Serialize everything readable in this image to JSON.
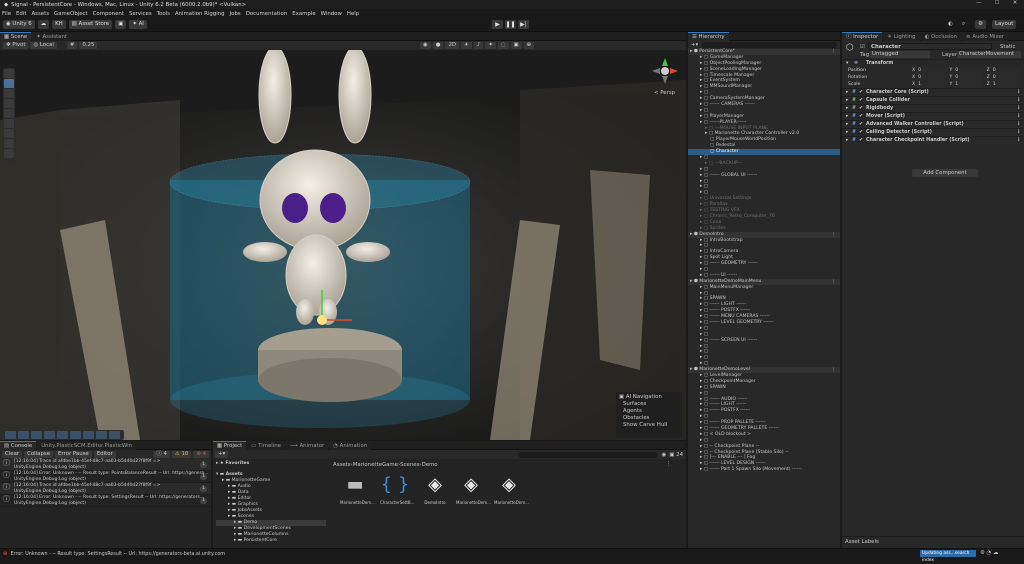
{
  "window": {
    "title": "Signal - PersistentCore - Windows, Mac, Linux - Unity 6.2 Beta (6000.2.0b9)* <Vulkan>",
    "minimize": "—",
    "maximize": "☐",
    "close": "✕"
  },
  "menu": [
    "File",
    "Edit",
    "Assets",
    "GameObject",
    "Component",
    "Services",
    "Tools",
    "Animation Rigging",
    "Jobs",
    "Documentation",
    "Example",
    "Window",
    "Help"
  ],
  "toolbar": {
    "account": "Unity 6",
    "user": "KH",
    "asset_store": "Asset Store",
    "ai": "AI",
    "layout": "Layout"
  },
  "scene_tabs": [
    "Scene",
    "Assistant"
  ],
  "scene_tools": {
    "pivot": "Pivot",
    "local": "Local",
    "snap": "0.25",
    "persp": "< Persp"
  },
  "ai_navigation": {
    "title": "AI Navigation",
    "items": [
      "Surfaces",
      "Agents",
      "Obstacles",
      "Show Carve Hull"
    ]
  },
  "hierarchy": {
    "tab": "Hierarchy",
    "rows": [
      {
        "t": "PersistentCore*",
        "d": 0,
        "k": "scene"
      },
      {
        "t": "GameManager",
        "d": 2
      },
      {
        "t": "ObjectPoolingManager",
        "d": 2
      },
      {
        "t": "SceneLoadingManager",
        "d": 2
      },
      {
        "t": "Timescale Manager",
        "d": 2
      },
      {
        "t": "EventSystem",
        "d": 2
      },
      {
        "t": "MMSoundManager",
        "d": 2
      },
      {
        "t": "",
        "d": 2
      },
      {
        "t": "CameraSystemManager",
        "d": 2
      },
      {
        "t": "------ CAMERAS ------",
        "d": 2
      },
      {
        "t": "",
        "d": 2
      },
      {
        "t": "PlayerManager",
        "d": 2
      },
      {
        "t": "------PLAYER------",
        "d": 2
      },
      {
        "t": "---MOUSE INPUT PLANE",
        "d": 3,
        "k": "dim"
      },
      {
        "t": "Marionette Character Controller v2.0",
        "d": 3
      },
      {
        "t": "PlayerMouseWorldPosition",
        "d": 4
      },
      {
        "t": "Pedestal",
        "d": 4
      },
      {
        "t": "Character",
        "d": 4,
        "k": "sel"
      },
      {
        "t": "",
        "d": 2
      },
      {
        "t": "---BACKUP---",
        "d": 3,
        "k": "dim"
      },
      {
        "t": "",
        "d": 2
      },
      {
        "t": "------ GLOBAL UI ------",
        "d": 2
      },
      {
        "t": "",
        "d": 2
      },
      {
        "t": "",
        "d": 2
      },
      {
        "t": "",
        "d": 2
      },
      {
        "t": "Universal Settings",
        "d": 2,
        "k": "dim"
      },
      {
        "t": "Parallax",
        "d": 2,
        "k": "dim"
      },
      {
        "t": "TESTING VFX",
        "d": 2,
        "k": "dim"
      },
      {
        "t": "Chronic_Retro_Computer_76",
        "d": 2,
        "k": "dim"
      },
      {
        "t": "Cone",
        "d": 2,
        "k": "dim"
      },
      {
        "t": "Sprites",
        "d": 2,
        "k": "dim"
      },
      {
        "t": "DemoIntro",
        "d": 0,
        "k": "scene"
      },
      {
        "t": "IntroBootstrap",
        "d": 2
      },
      {
        "t": "",
        "d": 2
      },
      {
        "t": "IntroCamera",
        "d": 2
      },
      {
        "t": "Spot Light",
        "d": 2
      },
      {
        "t": "------ GEOMETRY ------",
        "d": 2
      },
      {
        "t": "",
        "d": 2
      },
      {
        "t": "------ UI ------",
        "d": 2
      },
      {
        "t": "MarionetteDemoMainMenu",
        "d": 0,
        "k": "scene"
      },
      {
        "t": "MainMenuManager",
        "d": 2
      },
      {
        "t": "",
        "d": 2
      },
      {
        "t": "SPAWN",
        "d": 2
      },
      {
        "t": "------ LIGHT ------",
        "d": 2
      },
      {
        "t": "------ POSTFX ------",
        "d": 2
      },
      {
        "t": "------ MENU CAMERAS ------",
        "d": 2
      },
      {
        "t": "------ LEVEL GEOMETRY ------",
        "d": 2
      },
      {
        "t": "",
        "d": 2
      },
      {
        "t": "",
        "d": 2
      },
      {
        "t": "------ SCREEN UI ------",
        "d": 2
      },
      {
        "t": "",
        "d": 2
      },
      {
        "t": "",
        "d": 2
      },
      {
        "t": "",
        "d": 2
      },
      {
        "t": "",
        "d": 2
      },
      {
        "t": "MarionetteDemoLevel",
        "d": 0,
        "k": "scene"
      },
      {
        "t": "LevelManager",
        "d": 2
      },
      {
        "t": "CheckpointManager",
        "d": 2
      },
      {
        "t": "SPAWN",
        "d": 2
      },
      {
        "t": "",
        "d": 2
      },
      {
        "t": "------ AUDIO ------",
        "d": 2
      },
      {
        "t": "------ LIGHT ------",
        "d": 2
      },
      {
        "t": "------ POSTFX ------",
        "d": 2
      },
      {
        "t": "",
        "d": 2
      },
      {
        "t": "------ PROP PALLETE ------",
        "d": 2
      },
      {
        "t": "------ GEOMETRY PALLETE ------",
        "d": 2
      },
      {
        "t": "< OLD blockout >",
        "d": 2
      },
      {
        "t": "",
        "d": 2
      },
      {
        "t": "-- Checkpoint Plane --",
        "d": 2
      },
      {
        "t": "-- Checkpoint Plane (Stable Silo) --",
        "d": 2
      },
      {
        "t": "[--- ENABLE --- ] Fog",
        "d": 2
      },
      {
        "t": "------ LEVEL DESIGN ------",
        "d": 2
      },
      {
        "t": "------ Part 1 Spawn Silo (Movement) ------",
        "d": 2
      }
    ]
  },
  "inspector": {
    "tabs": [
      "Inspector",
      "Lighting",
      "Occlusion",
      "Audio Mixer"
    ],
    "name": "Character",
    "static": "Static",
    "tag_label": "Tag",
    "tag": "Untagged",
    "layer_label": "Layer",
    "layer": "CharacterMovement",
    "transform": {
      "title": "Transform",
      "rows": [
        {
          "label": "Position",
          "x": "0",
          "y": "0",
          "z": "0"
        },
        {
          "label": "Rotation",
          "x": "0",
          "y": "0",
          "z": "0"
        },
        {
          "label": "Scale",
          "x": "1",
          "y": "1",
          "z": "1"
        }
      ]
    },
    "components": [
      "Character Core (Script)",
      "Capsule Collider",
      "Rigidbody",
      "Mover (Script)",
      "Advanced Walker Controller (Script)",
      "Ceiling Detector (Script)",
      "Character Checkpoint Handler (Script)"
    ],
    "add_component": "Add Component",
    "asset_labels": "Asset Labels"
  },
  "console": {
    "tabs": [
      "Console",
      "Unity.PlasticSCM.Editor.PlasticWin"
    ],
    "buttons": [
      "Clear",
      "Collapse",
      "Error Pause",
      "Editor"
    ],
    "counts": {
      "info": "4",
      "warn": "10",
      "error": "4"
    },
    "logs": [
      {
        "l1": "[12:16:04] Trace id afdbe1bb-45ef-48c7-aa03-b5440d27f8f9f =>",
        "l2": "UnityEngine.Debug:Log (object)",
        "n": "1"
      },
      {
        "l1": "[12:16:04] Error: Unknown - -- Result type: PointsBalanceResult -- Url: https://genera...",
        "l2": "UnityEngine.Debug:Log (object)",
        "n": "1"
      },
      {
        "l1": "[12:16:04] Trace id afdbe1bb-45ef-48c7-aa03-b5440d27f8f9f =>",
        "l2": "UnityEngine.Debug:Log (object)",
        "n": "1"
      },
      {
        "l1": "[12:16:04] Error: Unknown - -- Result type: SettingsResult -- Url: https://generators...",
        "l2": "UnityEngine.Debug:Log (object)",
        "n": "1"
      }
    ]
  },
  "project": {
    "tabs": [
      "Project",
      "Timeline",
      "Animator",
      "Animation"
    ],
    "favorites": "Favorites",
    "assets": "Assets",
    "tree": [
      "MarionetteGame",
      "Audio",
      "Data",
      "Editor",
      "Graphics",
      "JobsAssets",
      "Scenes",
      "Demo",
      "DevelopmentScenes",
      "MarionetteColumns",
      "PersistentCore"
    ],
    "breadcrumb": [
      "Assets",
      "MarionetteGame",
      "Scenes",
      "Demo"
    ],
    "files": [
      "MarionetteDem...",
      "CharacterSettB...",
      "DemoIntro",
      "MarionetteDem...",
      "MarionetteDem..."
    ],
    "count": "24"
  },
  "status": {
    "message": "Error: Unknown - -- Result type: SettingsResult -- Url: https://generators-beta.ai.unity.com",
    "progress": "Updating ass...search index"
  }
}
